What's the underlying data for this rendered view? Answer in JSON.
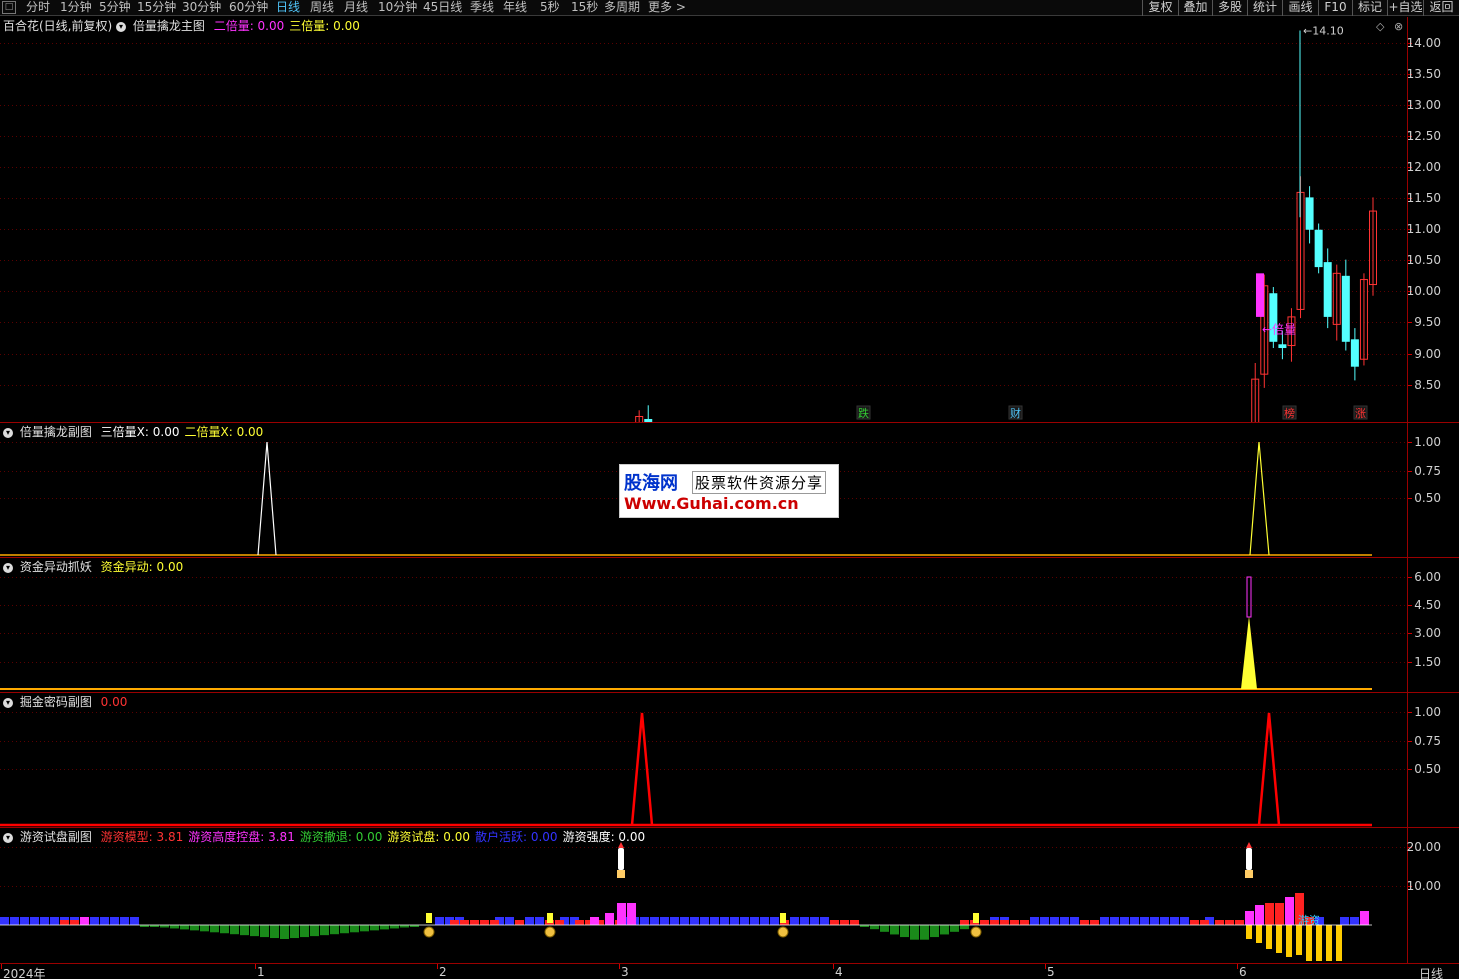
{
  "toolbar": {
    "periods": [
      "分时",
      "1分钟",
      "5分钟",
      "15分钟",
      "30分钟",
      "60分钟",
      "日线",
      "周线",
      "月线",
      "10分钟",
      "45日线",
      "季线",
      "年线",
      "5秒",
      "15秒",
      "多周期",
      "更多 >"
    ],
    "active_period": "日线",
    "right_tools": [
      "复权",
      "叠加",
      "多股",
      "统计",
      "画线",
      "F10",
      "标记",
      "+自选",
      "返回"
    ]
  },
  "main_panel": {
    "stock_title": "百合花(日线,前复权)",
    "indicator_name": "倍量擒龙主图",
    "fields": [
      {
        "label": "二倍量: ",
        "value": "0.00",
        "color": "#ff33ff"
      },
      {
        "label": "三倍量: ",
        "value": "0.00",
        "color": "#ffff33"
      }
    ],
    "y_labels": [
      "14.00",
      "13.50",
      "13.00",
      "12.50",
      "12.00",
      "11.50",
      "11.00",
      "10.50",
      "10.00",
      "9.50",
      "9.00",
      "8.50"
    ],
    "high_marker": "14.10",
    "low_marker": "8.21",
    "annotation_3x": "三倍量",
    "annotation_2x": "倍量",
    "event_tags": [
      {
        "text": "跌",
        "color": "#33cc33"
      },
      {
        "text": "财",
        "color": "#4fc3f7"
      },
      {
        "text": "榜",
        "color": "#ff3333"
      },
      {
        "text": "涨",
        "color": "#ff3333"
      }
    ]
  },
  "panel2": {
    "name": "倍量擒龙副图",
    "fields": [
      {
        "label": "三倍量X: ",
        "value": "0.00",
        "color": "#ffffff"
      },
      {
        "label": "二倍量X: ",
        "value": "0.00",
        "color": "#ffff33"
      }
    ],
    "y_labels": [
      "1.00",
      "0.75",
      "0.50"
    ]
  },
  "panel3": {
    "name": "资金异动抓妖",
    "fields": [
      {
        "label": "资金异动: ",
        "value": "0.00",
        "color": "#ffff33"
      }
    ],
    "y_labels": [
      "6.00",
      "4.50",
      "3.00",
      "1.50"
    ]
  },
  "panel4": {
    "name": "掘金密码副图",
    "fields": [
      {
        "label": "",
        "value": "0.00",
        "color": "#ff3333"
      }
    ],
    "y_labels": [
      "1.00",
      "0.75",
      "0.50"
    ]
  },
  "panel5": {
    "name": "游资试盘副图",
    "fields": [
      {
        "label": "游资模型: ",
        "value": "3.81",
        "color": "#ff3333"
      },
      {
        "label": "游资高度控盘: ",
        "value": "3.81",
        "color": "#ff33ff"
      },
      {
        "label": "游资撤退: ",
        "value": "0.00",
        "color": "#33cc33"
      },
      {
        "label": "游资试盘: ",
        "value": "0.00",
        "color": "#ffff33"
      },
      {
        "label": "散户活跃: ",
        "value": "0.00",
        "color": "#3333ff"
      },
      {
        "label": "游资强度: ",
        "value": "0.00",
        "color": "#ffffff"
      }
    ],
    "y_labels": [
      "20.00",
      "10.00"
    ],
    "bar_label": "游资"
  },
  "watermark": {
    "brand": "股海网",
    "slogan": "股票软件资源分享",
    "url": "Www.Guhai.com.cn"
  },
  "x_axis": {
    "labels": [
      "2024年",
      "1",
      "2",
      "3",
      "4",
      "5",
      "6"
    ],
    "period_label": "日线"
  },
  "colors": {
    "up": "#ff3333",
    "down": "#54ffff",
    "grid": "#5a0000",
    "border": "#9a0000"
  }
}
